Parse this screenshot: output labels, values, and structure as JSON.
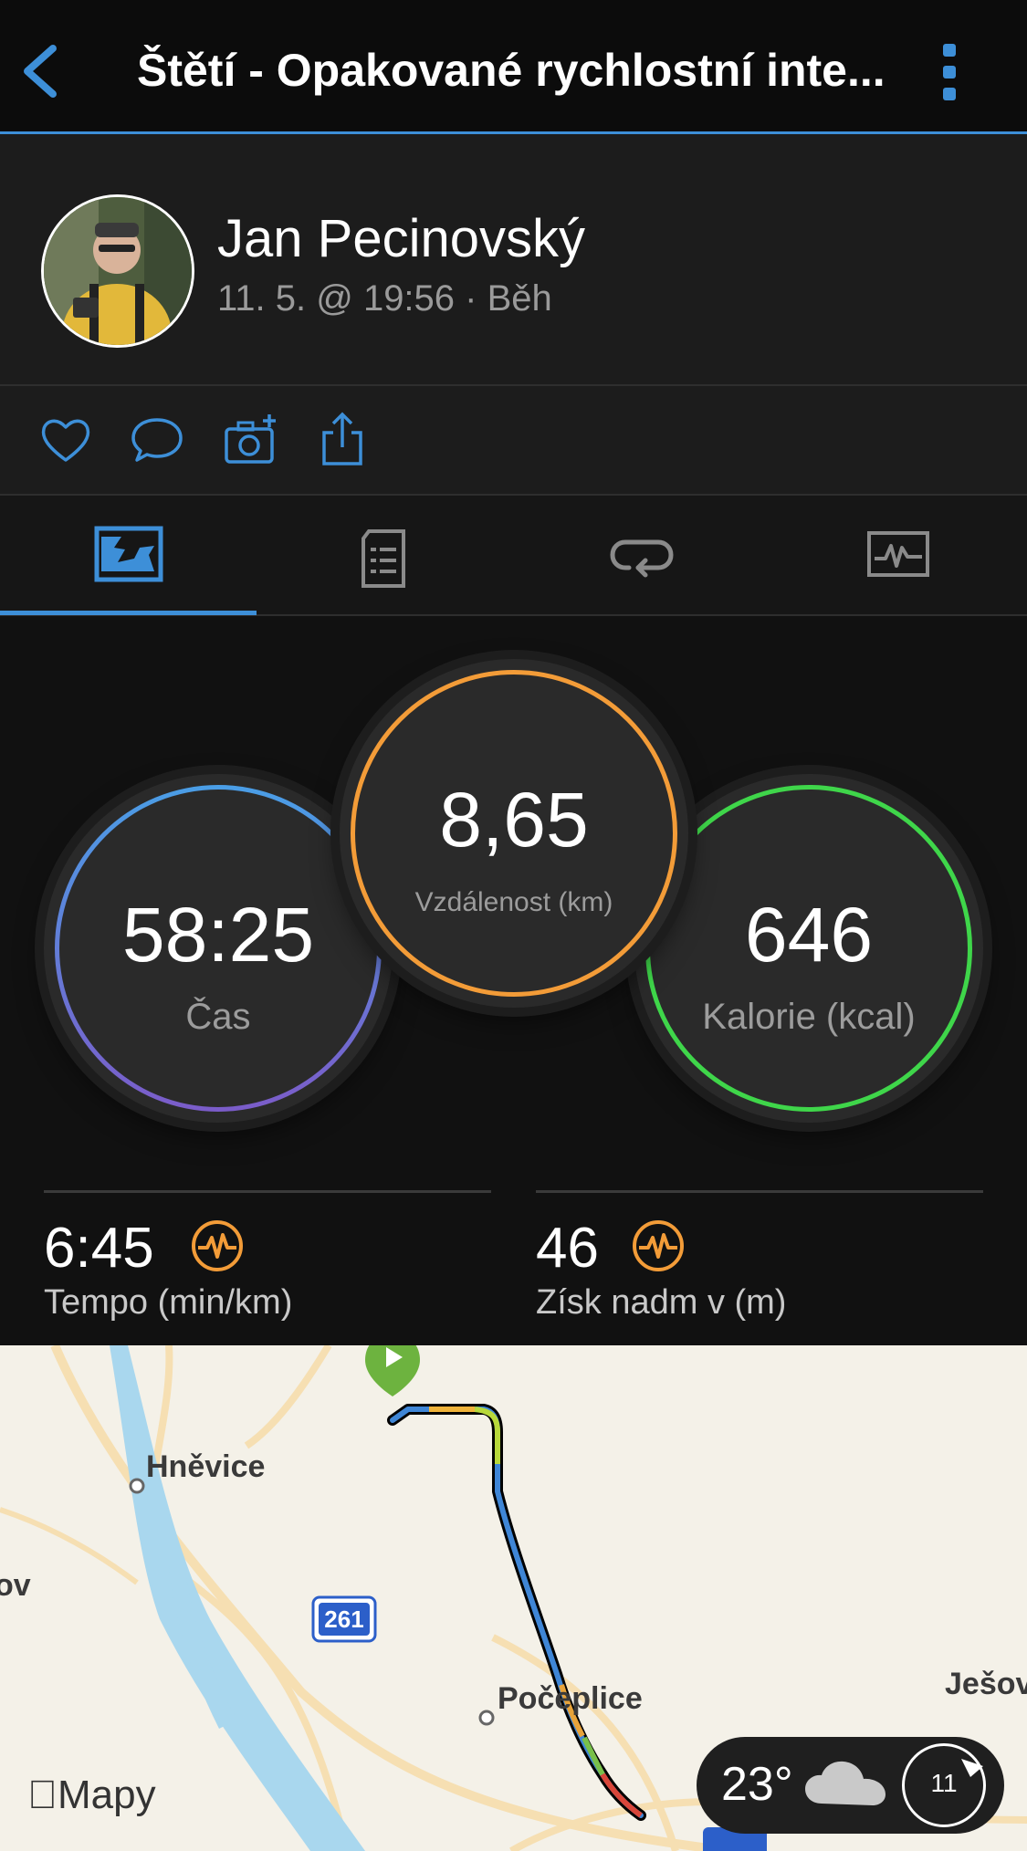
{
  "header": {
    "title": "Štětí - Opakované rychlostní inte...",
    "accent_color": "#3d8fd8",
    "back_icon": "chevron-left-icon",
    "more_icon": "kebab-menu-icon"
  },
  "profile": {
    "name": "Jan Pecinovský",
    "meta": "11. 5. @ 19:56 · Běh"
  },
  "actions": [
    {
      "icon": "heart-icon"
    },
    {
      "icon": "comment-icon"
    },
    {
      "icon": "add-photo-icon"
    },
    {
      "icon": "share-icon"
    }
  ],
  "tabs": [
    {
      "icon": "summary-map-icon",
      "active": true
    },
    {
      "icon": "details-list-icon",
      "active": false
    },
    {
      "icon": "laps-loop-icon",
      "active": false
    },
    {
      "icon": "charts-icon",
      "active": false
    }
  ],
  "stats": {
    "time": {
      "value": "58:25",
      "label": "Čas",
      "colors": [
        "#4a9ee6",
        "#7b5cc9"
      ]
    },
    "distance": {
      "value": "8,65",
      "label": "Vzdálenost (km)",
      "color": "#f39c38"
    },
    "calories": {
      "value": "646",
      "label": "Kalorie (kcal)",
      "color": "#3fd64a"
    }
  },
  "metrics": [
    {
      "value": "6:45",
      "label": "Tempo (min/km)",
      "icon": "activity-pulse-icon",
      "icon_color": "#f39c38"
    },
    {
      "value": "46",
      "label": "Získ nadm v (m)",
      "icon": "activity-pulse-icon",
      "icon_color": "#f39c38"
    }
  ],
  "map": {
    "places": [
      "Hněvice",
      "Počeplice",
      "ov",
      "Ješov"
    ],
    "road_badge": "261",
    "attribution": "Mapy",
    "weather": {
      "temperature": "23°",
      "icon": "cloud-icon",
      "wind": "11"
    }
  }
}
